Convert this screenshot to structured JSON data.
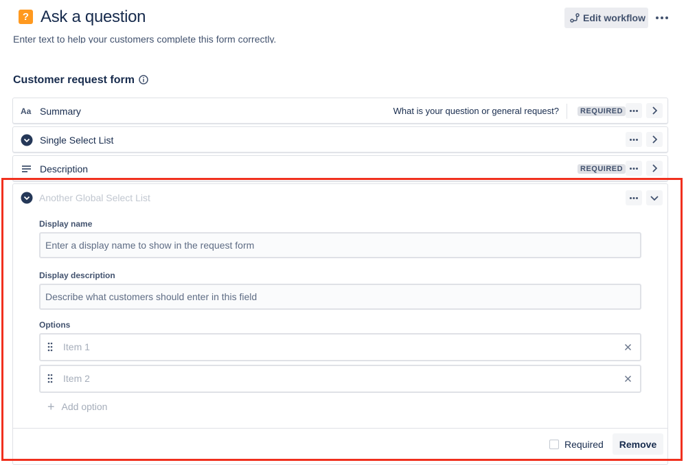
{
  "header": {
    "title": "Ask a question",
    "edit_workflow_label": "Edit workflow",
    "request_type_icon": "question-mark-icon"
  },
  "form_description_hint": "Enter text to help your customers complete this form correctly.",
  "form": {
    "title": "Customer request form",
    "fields": [
      {
        "icon": "text-field-icon",
        "label": "Summary",
        "help_text": "What is your question or general request?",
        "required_badge": "REQUIRED"
      },
      {
        "icon": "select-list-icon",
        "label": "Single Select List"
      },
      {
        "icon": "paragraph-icon",
        "label": "Description",
        "required_badge": "REQUIRED"
      }
    ],
    "expanded_field": {
      "icon": "select-list-icon",
      "label": "Another Global Select List",
      "display_name_label": "Display name",
      "display_name_placeholder": "Enter a display name to show in the request form",
      "display_description_label": "Display description",
      "display_description_placeholder": "Describe what customers should enter in this field",
      "options_label": "Options",
      "options": [
        {
          "placeholder": "Item 1"
        },
        {
          "placeholder": "Item 2"
        }
      ],
      "add_option_label": "Add option",
      "required_label": "Required",
      "required_checked": false,
      "remove_label": "Remove"
    }
  },
  "colors": {
    "highlight": "#f0301e",
    "request_icon_bg": "#ff991f",
    "text_primary": "#172b4d",
    "border": "#dfe1e6"
  }
}
